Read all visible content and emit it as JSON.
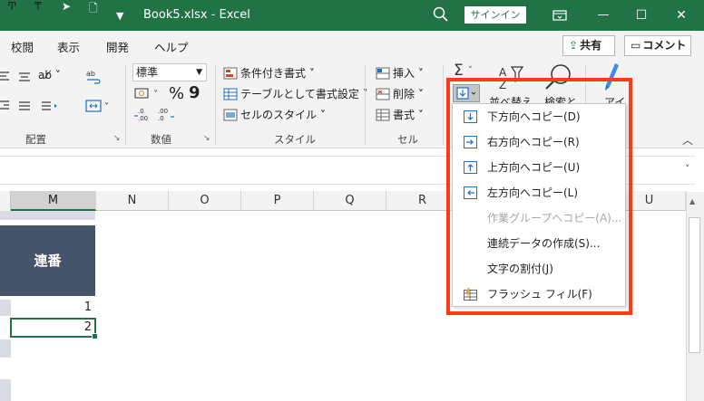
{
  "window": {
    "title": "Book5.xlsx  -  Excel",
    "signin_label": "サインイン",
    "minimize_glyph": "—",
    "maximize_glyph": "☐",
    "close_glyph": "✕"
  },
  "menu_tabs": [
    "校閲",
    "表示",
    "開発",
    "ヘルプ"
  ],
  "share_label": "共有",
  "comment_label": "コメント",
  "ribbon": {
    "number_format": "標準",
    "percent_glyph": "%",
    "comma_glyph": "9",
    "styles": {
      "conditional": "条件付き書式 ˅",
      "table": "テーブルとして書式設定 ˅",
      "cell_styles": "セルのスタイル ˅"
    },
    "cells": {
      "insert": "挿入 ˅",
      "delete": "削除 ˅",
      "format": "書式 ˅"
    },
    "editing": {
      "sort": "並べ替え",
      "find": "検索と",
      "ai": "アイ"
    },
    "groups": {
      "alignment": "配置",
      "number": "数値",
      "style": "スタイル",
      "cells": "セル"
    }
  },
  "columns": [
    "M",
    "N",
    "O",
    "P",
    "Q",
    "R",
    "U"
  ],
  "sheet": {
    "header_text": "連番",
    "cell_values": [
      "1",
      "2"
    ]
  },
  "fill_menu": {
    "items": [
      {
        "label": "下方向へコピー(D)",
        "enabled": true
      },
      {
        "label": "右方向へコピー(R)",
        "enabled": true
      },
      {
        "label": "上方向へコピー(U)",
        "enabled": true
      },
      {
        "label": "左方向へコピー(L)",
        "enabled": true
      },
      {
        "label": "作業グループへコピー(A)...",
        "enabled": false
      },
      {
        "label": "連続データの作成(S)...",
        "enabled": true
      },
      {
        "label": "文字の割付(J)",
        "enabled": true
      },
      {
        "label": "フラッシュ フィル(F)",
        "enabled": true
      }
    ]
  },
  "colors": {
    "excel_green": "#217346",
    "header_fill": "#44546a",
    "highlight": "#ff3b19"
  }
}
